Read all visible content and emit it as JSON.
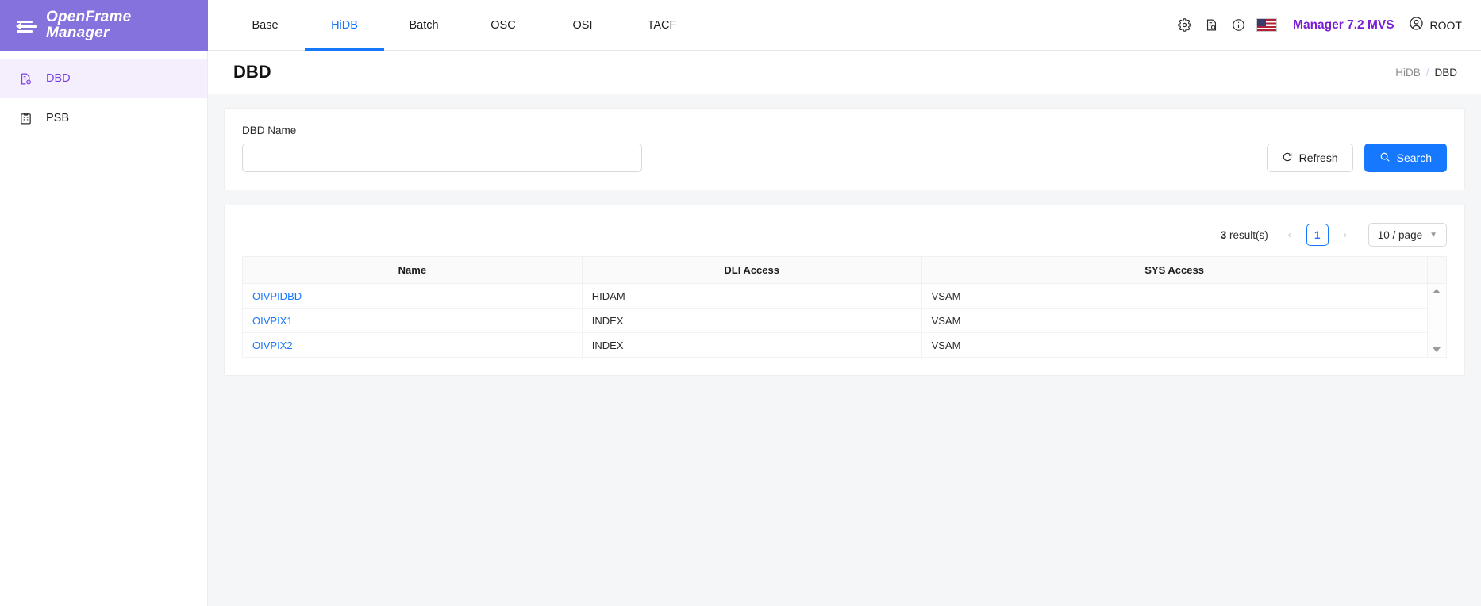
{
  "brand": {
    "line1": "OpenFrame",
    "line2": "Manager",
    "color": "#8572DC"
  },
  "header": {
    "tabs": [
      {
        "label": "Base",
        "active": false
      },
      {
        "label": "HiDB",
        "active": true
      },
      {
        "label": "Batch",
        "active": false
      },
      {
        "label": "OSC",
        "active": false
      },
      {
        "label": "OSI",
        "active": false
      },
      {
        "label": "TACF",
        "active": false
      }
    ],
    "icons": [
      "gear-icon",
      "document-search-icon",
      "info-icon",
      "flag-us-icon"
    ],
    "manager_label": "Manager 7.2 MVS",
    "manager_color": "#7a1fd4",
    "user_label": "ROOT"
  },
  "sidebar": {
    "items": [
      {
        "label": "DBD",
        "icon": "document-config-icon",
        "active": true
      },
      {
        "label": "PSB",
        "icon": "clipboard-icon",
        "active": false
      }
    ]
  },
  "page": {
    "title": "DBD",
    "breadcrumb": {
      "parent": "HiDB",
      "separator": "/",
      "current": "DBD"
    }
  },
  "search": {
    "label": "DBD Name",
    "value": "",
    "placeholder": "",
    "refresh_label": "Refresh",
    "search_label": "Search"
  },
  "table": {
    "results_count": "3",
    "results_suffix": " result(s)",
    "prev_label": "‹",
    "next_label": "›",
    "page_number": "1",
    "page_size_label": "10 / page",
    "columns": [
      "Name",
      "DLI Access",
      "SYS Access"
    ],
    "rows": [
      {
        "name": "OIVPIDBD",
        "dli_access": "HIDAM",
        "sys_access": "VSAM"
      },
      {
        "name": "OIVPIX1",
        "dli_access": "INDEX",
        "sys_access": "VSAM"
      },
      {
        "name": "OIVPIX2",
        "dli_access": "INDEX",
        "sys_access": "VSAM"
      }
    ]
  },
  "colors": {
    "accent_blue": "#1677ff",
    "brand_purple": "#8572DC",
    "link_blue": "#1677ff"
  }
}
